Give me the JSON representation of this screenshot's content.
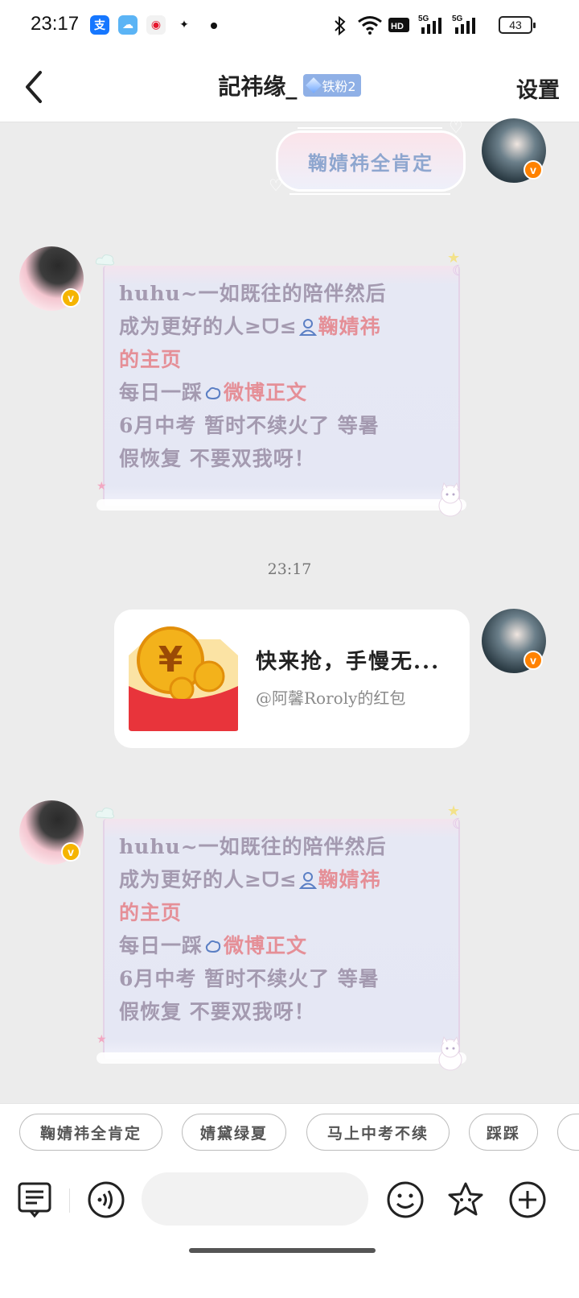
{
  "status_bar": {
    "time": "23:17",
    "apps": [
      {
        "name": "alipay-icon",
        "glyph": "支",
        "color": "#1677ff"
      },
      {
        "name": "weather-icon",
        "glyph": "☁",
        "color": "#3ea0f5"
      },
      {
        "name": "weibo-icon",
        "glyph": "◉",
        "color": "#ff8a00"
      },
      {
        "name": "wechat-icon",
        "glyph": "✦",
        "color": "#111111"
      }
    ],
    "battery": "43"
  },
  "header": {
    "back_label": "<",
    "title": "記祎缘_",
    "fan_badge": "铁粉2",
    "settings_label": "设置"
  },
  "messages": {
    "top_bubble_text": "鞠婧祎全肯定",
    "card1": {
      "line1": "huhu~一如既往的陪伴然后",
      "line2_a": "成为更好的人≥ᗜ≤",
      "line2_b": "鞠婧祎",
      "line3": "的主页",
      "line4_a": "每日一踩",
      "line4_b": "微博正文",
      "line5": "6月中考 暂时不续火了 等暑",
      "line6": "假恢复 不要双我呀！"
    },
    "timestamp": "23:17",
    "redpacket": {
      "title": "快来抢，手慢无...",
      "subtitle": "@阿馨Roroly的红包",
      "yen": "¥"
    },
    "card2": {
      "line1": "huhu~一如既往的陪伴然后",
      "line2_a": "成为更好的人≥ᗜ≤",
      "line2_b": "鞠婧祎",
      "line3": "的主页",
      "line4_a": "每日一踩",
      "line4_b": "微博正文",
      "line5": "6月中考 暂时不续火了 等暑",
      "line6": "假恢复 不要双我呀！"
    }
  },
  "quick_replies": [
    "鞠婧祎全肯定",
    "婧黛绿夏",
    "马上中考不续",
    "踩踩",
    ""
  ],
  "input": {
    "placeholder": ""
  },
  "colors": {
    "accent_pink": "#e58f97",
    "card_text": "#a49ab0",
    "bubble_text": "#8ea6cf",
    "verified_orange": "#ff8200",
    "verified_gold": "#f5b400"
  }
}
